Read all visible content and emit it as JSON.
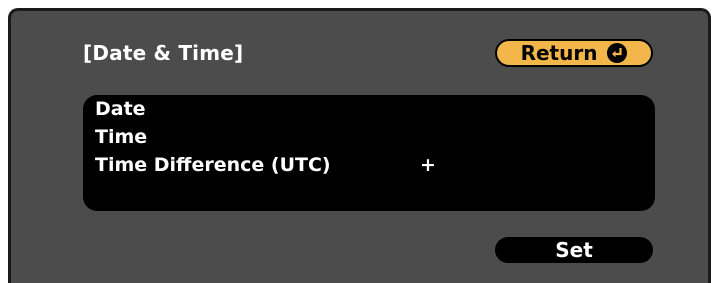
{
  "dialog": {
    "title": "[Date & Time]"
  },
  "return_button": {
    "label": "Return",
    "icon": "enter-icon",
    "accent_color": "#f3b64a"
  },
  "settings": {
    "rows": [
      {
        "label": "Date",
        "value": ""
      },
      {
        "label": "Time",
        "value": ""
      },
      {
        "label": "Time Difference (UTC)",
        "value": "+"
      },
      {
        "label": "",
        "value": ""
      }
    ]
  },
  "set_button": {
    "label": "Set"
  }
}
